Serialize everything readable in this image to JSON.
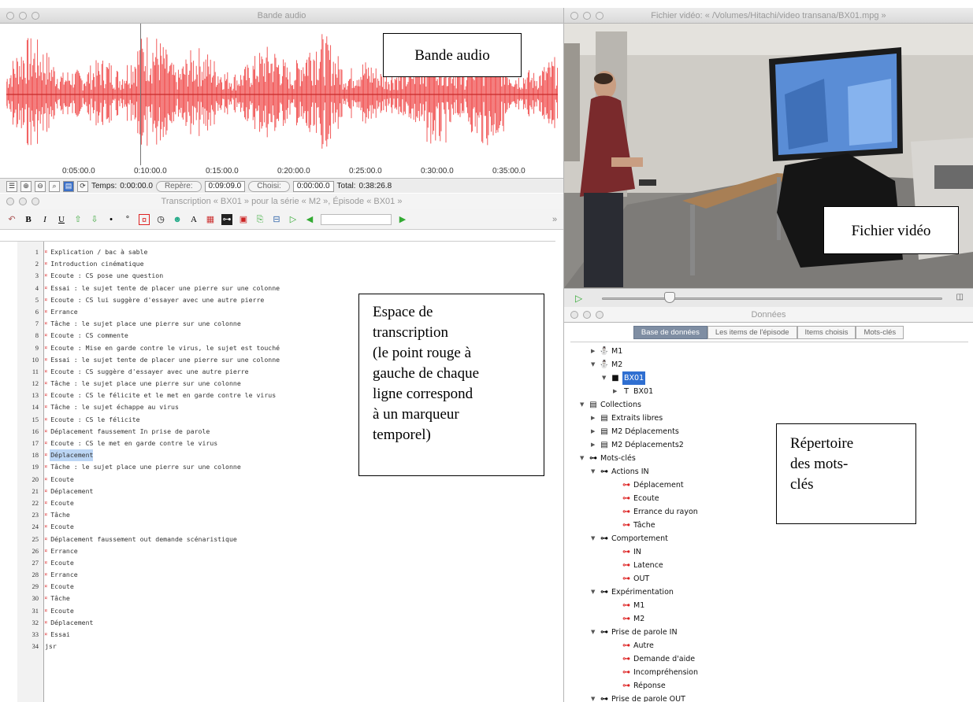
{
  "audio": {
    "title": "Bande audio",
    "time_marks": [
      "0:05:00.0",
      "0:10:00.0",
      "0:15:00.0",
      "0:20:00.0",
      "0:25:00.0",
      "0:30:00.0",
      "0:35:00.0"
    ],
    "temps_label": "Temps:",
    "temps_value": "0:00:00.0",
    "repere_label": "Repère:",
    "repere_value": "0:09:09.0",
    "choisi_label": "Choisi:",
    "choisi_value": "0:00:00.0",
    "total_label": "Total:",
    "total_value": "0:38:26.8",
    "wave_color": "#f04848"
  },
  "transcript": {
    "title": "Transcription « BX01 » pour la série « M2 », Épisode « BX01 »",
    "lines": [
      {
        "n": "1",
        "text": "Explication / bac à sable"
      },
      {
        "n": "2",
        "text": "Introduction cinématique"
      },
      {
        "n": "3",
        "text": "Ecoute : CS pose une question"
      },
      {
        "n": "4",
        "text": "Essai : le sujet tente de placer une pierre sur une colonne"
      },
      {
        "n": "5",
        "text": "Ecoute : CS lui suggère d'essayer avec une autre pierre"
      },
      {
        "n": "6",
        "text": "Errance"
      },
      {
        "n": "7",
        "text": "Tâche : le sujet place une pierre sur une colonne"
      },
      {
        "n": "8",
        "text": "Ecoute : CS commente"
      },
      {
        "n": "9",
        "text": "Ecoute : Mise en garde contre le virus, le sujet est touché"
      },
      {
        "n": "10",
        "text": "Essai : le sujet tente de placer une pierre sur une colonne"
      },
      {
        "n": "11",
        "text": "Ecoute : CS suggère d'essayer avec une autre pierre"
      },
      {
        "n": "12",
        "text": "Tâche : le sujet place une pierre sur une colonne"
      },
      {
        "n": "13",
        "text": "Ecoute : CS le félicite et le met en garde contre le virus"
      },
      {
        "n": "14",
        "text": "Tâche : le sujet échappe au virus"
      },
      {
        "n": "15",
        "text": "Ecoute : CS le félicite"
      },
      {
        "n": "16",
        "text": "Déplacement faussement In prise de parole"
      },
      {
        "n": "17",
        "text": "Ecoute : CS le met en garde contre le virus"
      },
      {
        "n": "18",
        "text": "Déplacement",
        "selected": true
      },
      {
        "n": "19",
        "text": "Tâche : le sujet place une pierre sur une colonne"
      },
      {
        "n": "20",
        "text": "Ecoute"
      },
      {
        "n": "21",
        "text": "Déplacement"
      },
      {
        "n": "22",
        "text": "Ecoute"
      },
      {
        "n": "23",
        "text": "Tâche"
      },
      {
        "n": "24",
        "text": "Ecoute"
      },
      {
        "n": "25",
        "text": "Déplacement faussement out demande scénaristique"
      },
      {
        "n": "26",
        "text": "Errance"
      },
      {
        "n": "27",
        "text": "Ecoute"
      },
      {
        "n": "28",
        "text": "Errance"
      },
      {
        "n": "29",
        "text": "Ecoute"
      },
      {
        "n": "30",
        "text": "Tâche"
      },
      {
        "n": "31",
        "text": "Ecoute"
      },
      {
        "n": "32",
        "text": "Déplacement"
      },
      {
        "n": "33",
        "text": "Essai"
      },
      {
        "n": "34",
        "text": "jsr",
        "no_marker": true
      }
    ]
  },
  "video": {
    "title": "Fichier vidéo: « /Volumes/Hitachi/video transana/BX01.mpg »",
    "slider_position": 0.2
  },
  "data_window": {
    "title": "Données",
    "tabs": [
      {
        "label": "Base de données",
        "active": true
      },
      {
        "label": "Les items de l'épisode",
        "active": false
      },
      {
        "label": "Items choisis",
        "active": false
      },
      {
        "label": "Mots-clés",
        "active": false
      }
    ],
    "tree": [
      {
        "level": 1,
        "tri": "▶",
        "icon": "series",
        "label": "M1"
      },
      {
        "level": 1,
        "tri": "▼",
        "icon": "series",
        "label": "M2"
      },
      {
        "level": 2,
        "tri": "▼",
        "icon": "episode",
        "label": "BX01",
        "selected": true
      },
      {
        "level": 3,
        "tri": "▶",
        "icon": "transcript",
        "label": "BX01"
      },
      {
        "level": 0,
        "tri": "▼",
        "icon": "collection",
        "label": "Collections"
      },
      {
        "level": 1,
        "tri": "▶",
        "icon": "collection",
        "label": "Extraits libres"
      },
      {
        "level": 1,
        "tri": "▶",
        "icon": "collection",
        "label": "M2 Déplacements"
      },
      {
        "level": 1,
        "tri": "▶",
        "icon": "collection",
        "label": "M2 Déplacements2"
      },
      {
        "level": 0,
        "tri": "▼",
        "icon": "keyroot",
        "label": "Mots-clés"
      },
      {
        "level": 1,
        "tri": "▼",
        "icon": "keygroup",
        "label": "Actions IN"
      },
      {
        "level": 3,
        "tri": "",
        "icon": "key",
        "label": "Déplacement"
      },
      {
        "level": 3,
        "tri": "",
        "icon": "key",
        "label": "Ecoute"
      },
      {
        "level": 3,
        "tri": "",
        "icon": "key",
        "label": "Errance du rayon"
      },
      {
        "level": 3,
        "tri": "",
        "icon": "key",
        "label": "Tâche"
      },
      {
        "level": 1,
        "tri": "▼",
        "icon": "keygroup",
        "label": "Comportement"
      },
      {
        "level": 3,
        "tri": "",
        "icon": "key",
        "label": "IN"
      },
      {
        "level": 3,
        "tri": "",
        "icon": "key",
        "label": "Latence"
      },
      {
        "level": 3,
        "tri": "",
        "icon": "key",
        "label": "OUT"
      },
      {
        "level": 1,
        "tri": "▼",
        "icon": "keygroup",
        "label": "Expérimentation"
      },
      {
        "level": 3,
        "tri": "",
        "icon": "key",
        "label": "M1"
      },
      {
        "level": 3,
        "tri": "",
        "icon": "key",
        "label": "M2"
      },
      {
        "level": 1,
        "tri": "▼",
        "icon": "keygroup",
        "label": "Prise de parole IN"
      },
      {
        "level": 3,
        "tri": "",
        "icon": "key",
        "label": "Autre"
      },
      {
        "level": 3,
        "tri": "",
        "icon": "key",
        "label": "Demande d'aide"
      },
      {
        "level": 3,
        "tri": "",
        "icon": "key",
        "label": "Incompréhension"
      },
      {
        "level": 3,
        "tri": "",
        "icon": "key",
        "label": "Réponse"
      },
      {
        "level": 1,
        "tri": "▼",
        "icon": "keygroup",
        "label": "Prise de parole OUT"
      }
    ]
  },
  "annotations": {
    "audio": "Bande audio",
    "video": "Fichier vidéo",
    "transcription": [
      "Espace de",
      "transcription",
      "(le point rouge à",
      "gauche de chaque",
      "ligne correspond",
      "à un marqueur",
      "temporel)"
    ],
    "keywords": [
      "Répertoire",
      "des mots-",
      "clés"
    ]
  }
}
